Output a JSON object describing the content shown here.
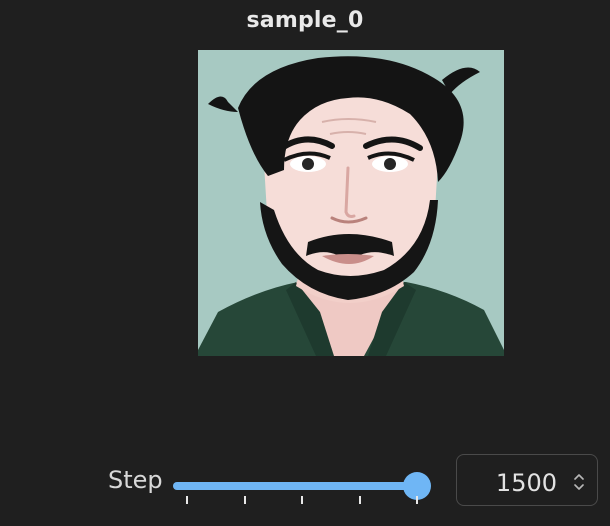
{
  "panel": {
    "title": "sample_0"
  },
  "image": {
    "icon": "portrait-image"
  },
  "controls": {
    "label": "Step",
    "value": "1500",
    "slider": {
      "fraction": 1.0,
      "tick_count": 5
    }
  },
  "colors": {
    "background": "#1f1f1f",
    "accent": "#6fb6f5",
    "image_bg": "#a7c9c2"
  }
}
